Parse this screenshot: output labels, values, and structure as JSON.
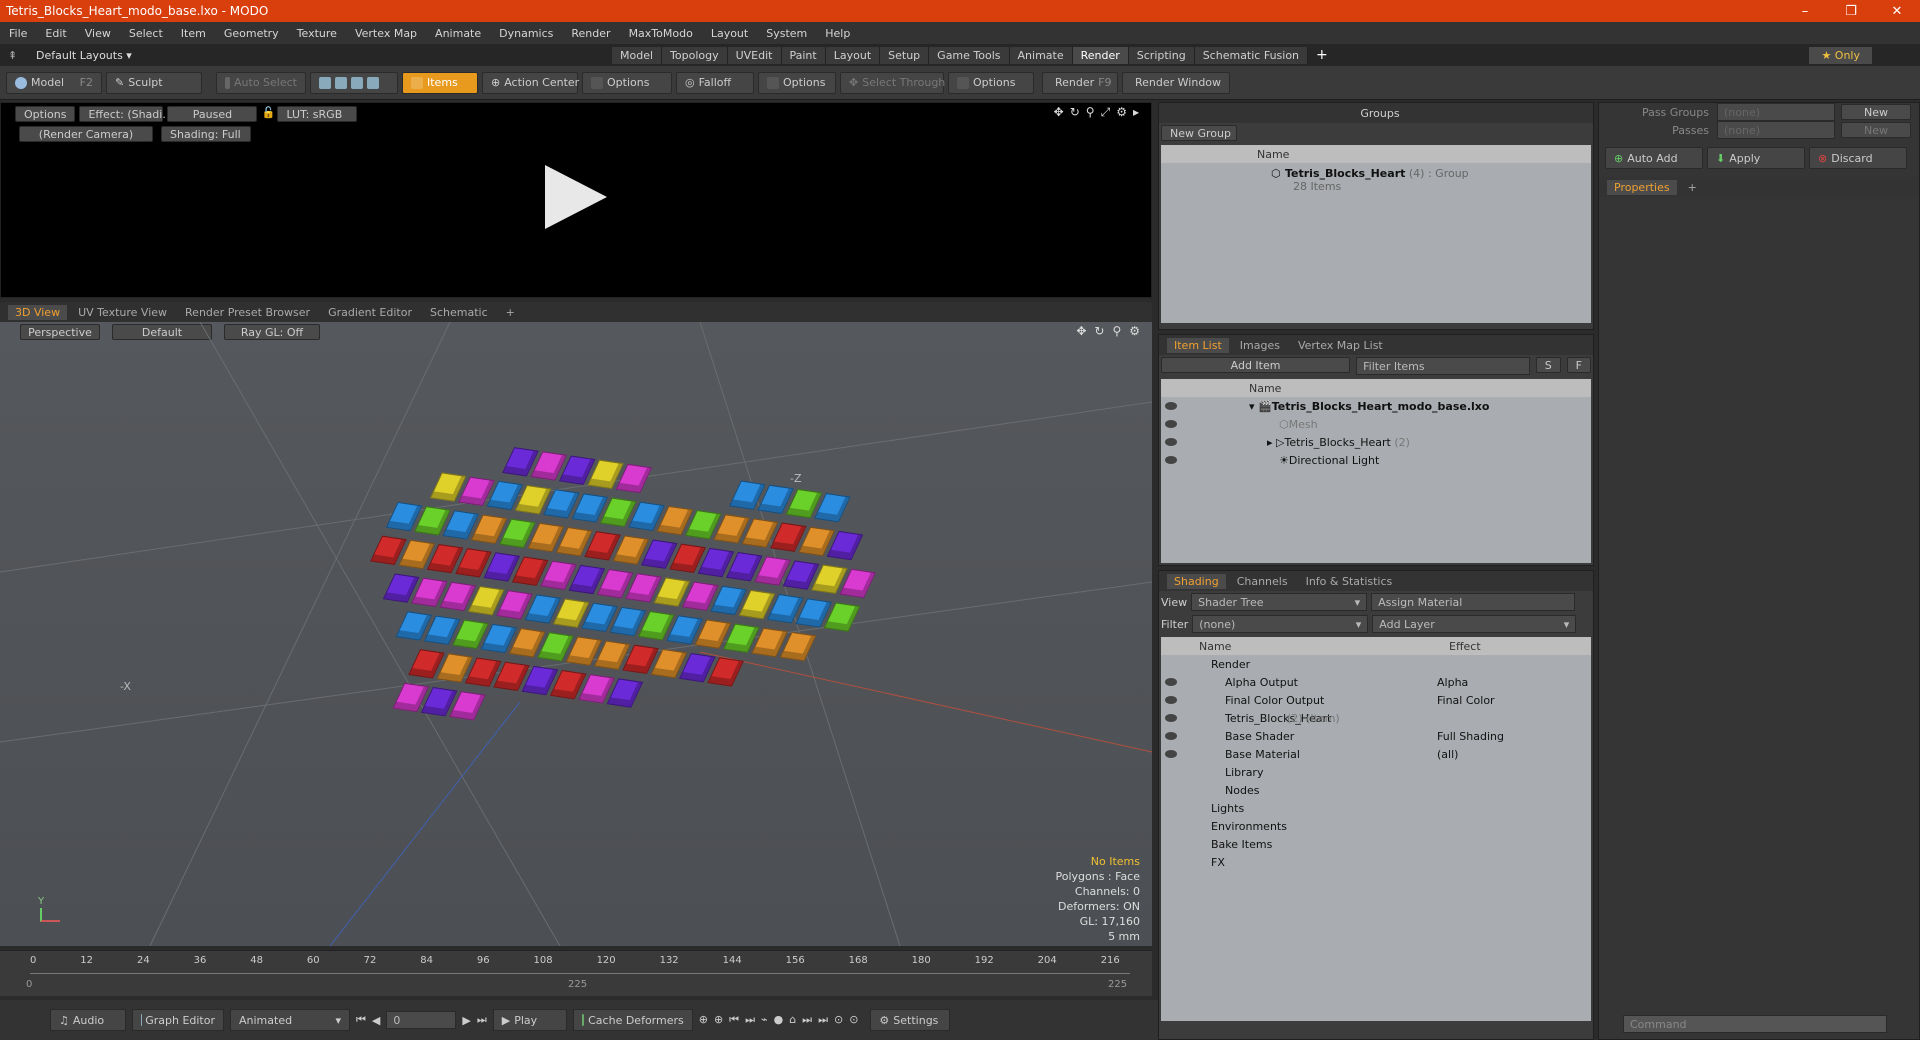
{
  "window": {
    "title": "Tetris_Blocks_Heart_modo_base.lxo - MODO",
    "min": "–",
    "max": "❐",
    "close": "✕"
  },
  "menu": [
    "File",
    "Edit",
    "View",
    "Select",
    "Item",
    "Geometry",
    "Texture",
    "Vertex Map",
    "Animate",
    "Dynamics",
    "Render",
    "MaxToModo",
    "Layout",
    "System",
    "Help"
  ],
  "layouts": {
    "label": "Default Layouts ▾",
    "tabs": [
      "Model",
      "Topology",
      "UVEdit",
      "Paint",
      "Layout",
      "Setup",
      "Game Tools",
      "Animate",
      "Render",
      "Scripting",
      "Schematic Fusion"
    ],
    "active": "Render",
    "add": "+",
    "only": "★  Only"
  },
  "toolbar": {
    "model": "Model",
    "model_key": "F2",
    "sculpt": "Sculpt",
    "auto_select": "Auto Select",
    "items": "Items",
    "action_center": "Action Center",
    "options1": "Options",
    "falloff": "Falloff",
    "options2": "Options",
    "select_through": "Select Through",
    "options3": "Options",
    "render": "Render",
    "render_key": "F9",
    "render_window": "Render Window"
  },
  "preview": {
    "options": "Options",
    "effect": "Effect: (Shadi...",
    "paused": "Paused",
    "lut": "LUT: sRGB",
    "camera": "(Render Camera)",
    "shading": "Shading: Full"
  },
  "viewport": {
    "tabs": [
      "3D View",
      "UV Texture View",
      "Render Preset Browser",
      "Gradient Editor",
      "Schematic"
    ],
    "active": "3D View",
    "add": "+",
    "perspective": "Perspective",
    "default": "Default",
    "raygl": "Ray GL: Off",
    "axis_z": "-Z",
    "axis_x": "-X",
    "axis_y": "Y",
    "stats": {
      "no_items": "No Items",
      "polygons": "Polygons : Face",
      "channels": "Channels: 0",
      "deformers": "Deformers: ON",
      "gl": "GL: 17,160",
      "unit": "5 mm"
    }
  },
  "timeline": {
    "ticks": [
      "0",
      "12",
      "24",
      "36",
      "48",
      "60",
      "72",
      "84",
      "96",
      "108",
      "120",
      "132",
      "144",
      "156",
      "168",
      "180",
      "192",
      "204",
      "216"
    ],
    "start": "0",
    "mid": "225",
    "end": "225"
  },
  "bottombar": {
    "audio": "Audio",
    "graph_editor": "Graph Editor",
    "animated": "Animated",
    "frame": "0",
    "play": "Play",
    "cache": "Cache Deformers",
    "settings": "Settings"
  },
  "groups": {
    "title": "Groups",
    "new_group": "New Group",
    "col_name": "Name",
    "item": "Tetris_Blocks_Heart",
    "item_count": "(4)",
    "item_type": ": Group",
    "item_sub": "28 Items"
  },
  "itemlist": {
    "tabs": [
      "Item List",
      "Images",
      "Vertex Map List"
    ],
    "add_item": "Add Item",
    "filter": "Filter Items",
    "s": "S",
    "f": "F",
    "col_name": "Name",
    "rows": [
      {
        "label": "Tetris_Blocks_Heart_modo_base.lxo",
        "extra": ""
      },
      {
        "label": "Mesh",
        "extra": ""
      },
      {
        "label": "Tetris_Blocks_Heart",
        "extra": "(2)"
      },
      {
        "label": "Directional Light",
        "extra": ""
      }
    ]
  },
  "shading": {
    "tabs": [
      "Shading",
      "Channels",
      "Info & Statistics"
    ],
    "view_label": "View",
    "view": "Shader Tree",
    "assign": "Assign Material",
    "filter_label": "Filter",
    "filter": "(none)",
    "add_layer": "Add Layer",
    "col_name": "Name",
    "col_effect": "Effect",
    "rows": [
      {
        "label": "Render",
        "effect": ""
      },
      {
        "label": "Alpha Output",
        "effect": "Alpha"
      },
      {
        "label": "Final Color Output",
        "effect": "Final Color"
      },
      {
        "label": "Tetris_Blocks_Heart",
        "extra": "(2) (Item)",
        "effect": ""
      },
      {
        "label": "Base Shader",
        "effect": "Full Shading"
      },
      {
        "label": "Base Material",
        "effect": "(all)"
      },
      {
        "label": "Library",
        "effect": ""
      },
      {
        "label": "Nodes",
        "effect": ""
      },
      {
        "label": "Lights",
        "effect": ""
      },
      {
        "label": "Environments",
        "effect": ""
      },
      {
        "label": "Bake Items",
        "effect": ""
      },
      {
        "label": "FX",
        "effect": ""
      }
    ]
  },
  "props": {
    "pass_groups": "Pass Groups",
    "passes": "Passes",
    "none1": "(none)",
    "none2": "(none)",
    "new1": "New",
    "new2": "New",
    "auto_add": "Auto Add",
    "apply": "Apply",
    "discard": "Discard",
    "tab": "Properties",
    "command": "Command"
  },
  "colors": {
    "accent": "#e89a1e",
    "title": "#d93e0d"
  }
}
